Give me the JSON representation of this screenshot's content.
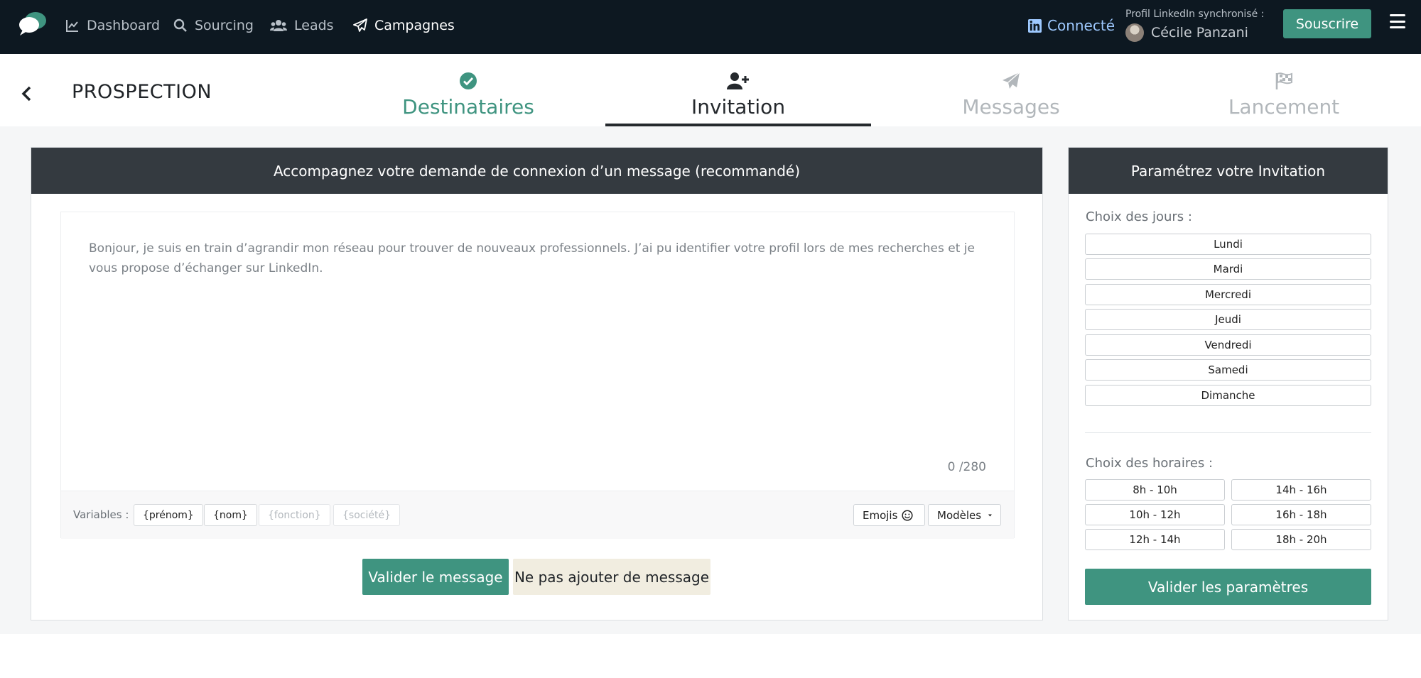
{
  "nav": {
    "items": [
      {
        "label": "Dashboard",
        "icon": "chart-line-icon"
      },
      {
        "label": "Sourcing",
        "icon": "search-icon"
      },
      {
        "label": "Leads",
        "icon": "users-icon"
      },
      {
        "label": "Campagnes",
        "icon": "paper-plane-icon",
        "active": true
      }
    ],
    "connected": "Connecté",
    "sync_label": "Profil LinkedIn synchronisé :",
    "sync_user": "Cécile Panzani",
    "subscribe": "Souscrire"
  },
  "page": {
    "title": "PROSPECTION",
    "steps": [
      {
        "label": "Destinataires",
        "state": "done",
        "icon": "check-circle-icon"
      },
      {
        "label": "Invitation",
        "state": "current",
        "icon": "user-plus-icon"
      },
      {
        "label": "Messages",
        "state": "todo",
        "icon": "paper-plane-icon"
      },
      {
        "label": "Lancement",
        "state": "todo",
        "icon": "checkered-flag-icon"
      }
    ]
  },
  "message_panel": {
    "header": "Accompagnez votre demande de connexion d’un message (recommandé)",
    "text": "Bonjour, je suis en train d’agrandir mon réseau pour trouver de nouveaux professionnels. J’ai pu identifier votre profil lors de mes recherches et je vous propose d’échanger sur LinkedIn.",
    "counter": "0 /280",
    "variables_label": "Variables :",
    "variables": [
      {
        "label": "{prénom}",
        "enabled": true
      },
      {
        "label": "{nom}",
        "enabled": true
      },
      {
        "label": "{fonction}",
        "enabled": false
      },
      {
        "label": "{société}",
        "enabled": false
      }
    ],
    "emojis_label": "Emojis",
    "models_label": "Modèles",
    "validate_label": "Valider le message",
    "skip_label": "Ne pas ajouter de message"
  },
  "settings_panel": {
    "header": "Paramétrez votre Invitation",
    "days_label": "Choix des jours :",
    "days": [
      "Lundi",
      "Mardi",
      "Mercredi",
      "Jeudi",
      "Vendredi",
      "Samedi",
      "Dimanche"
    ],
    "hours_label": "Choix des horaires :",
    "hours": [
      "8h - 10h",
      "14h - 16h",
      "10h - 12h",
      "16h - 18h",
      "12h - 14h",
      "18h - 20h"
    ],
    "validate_label": "Valider les paramètres"
  },
  "colors": {
    "accent": "#3f9480",
    "nav_bg": "#0d1821",
    "panel_header": "#343a40"
  }
}
